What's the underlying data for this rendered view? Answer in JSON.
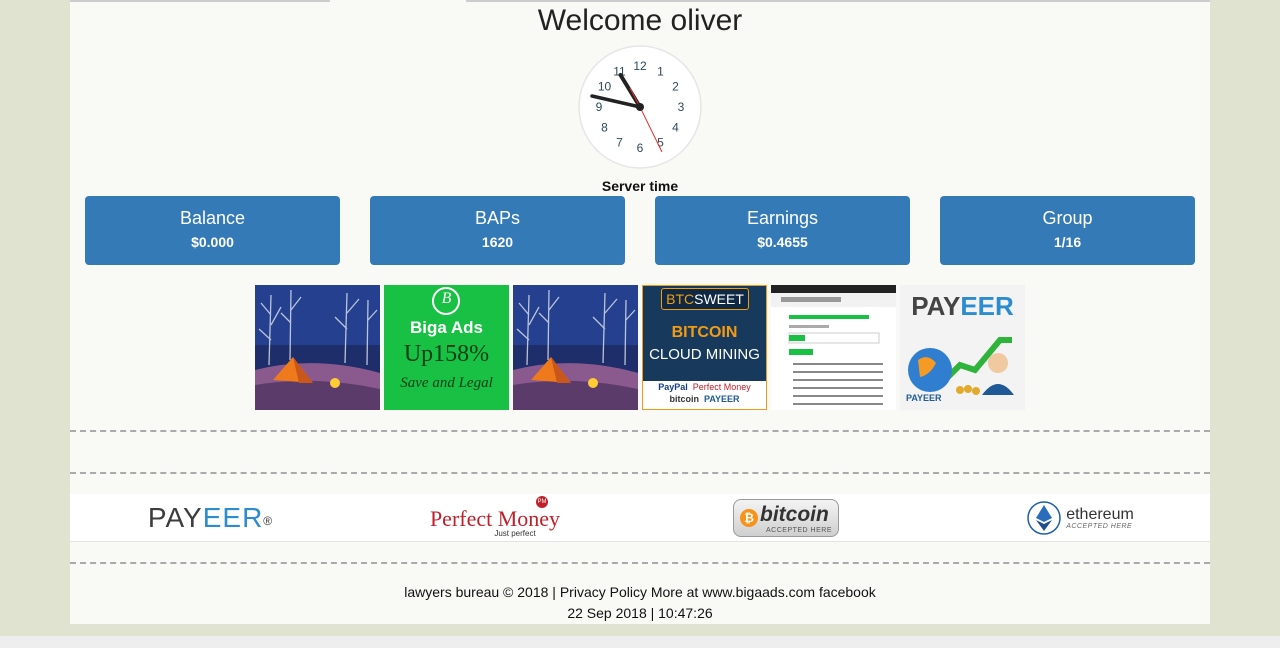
{
  "header": {
    "welcome": "Welcome oliver"
  },
  "clock": {
    "numbers": [
      "12",
      "1",
      "2",
      "3",
      "4",
      "5",
      "6",
      "7",
      "8",
      "9",
      "10",
      "11"
    ],
    "caption": "Server time"
  },
  "stats": [
    {
      "title": "Balance",
      "value": "$0.000"
    },
    {
      "title": "BAPs",
      "value": "1620"
    },
    {
      "title": "Earnings",
      "value": "$0.4655"
    },
    {
      "title": "Group",
      "value": "1/16"
    }
  ],
  "ads": {
    "biga": {
      "brand": "Biga Ads",
      "tagline": "Up158%",
      "slogan": "Save and Legal",
      "logo_letter": "B"
    },
    "btcsweet": {
      "brand_a": "BTC",
      "brand_b": "SWEET",
      "line1": "BITCOIN",
      "line2": "CLOUD MINING",
      "pay1": "PayPal",
      "pay2": "Perfect Money",
      "pay3": "bitcoin",
      "pay4": "PAYEER"
    },
    "payeer": {
      "brand_a": "PAY",
      "brand_b": "EER",
      "small": "PAYEER"
    }
  },
  "payments": {
    "payeer": {
      "a": "PAY",
      "b": "EER",
      "reg": "®"
    },
    "perfect_money": {
      "name": "Perfect Money",
      "sub": "Just perfect",
      "badge": "PM"
    },
    "bitcoin": {
      "name": "bitcoin",
      "sub": "ACCEPTED HERE",
      "symbol": "₿"
    },
    "ethereum": {
      "name": "ethereum",
      "sub": "ACCEPTED HERE"
    }
  },
  "footer": {
    "copyright": "lawyers bureau © 2018 |",
    "privacy": "Privacy Policy",
    "more": "More at www.bigaads.com",
    "facebook": "facebook",
    "datetime": "22 Sep 2018 | 10:47:26"
  },
  "colors": {
    "stat_bg": "#337ab7",
    "biga_green": "#18c143",
    "btc_navy": "#173a5c",
    "btc_orange": "#f39c12"
  }
}
